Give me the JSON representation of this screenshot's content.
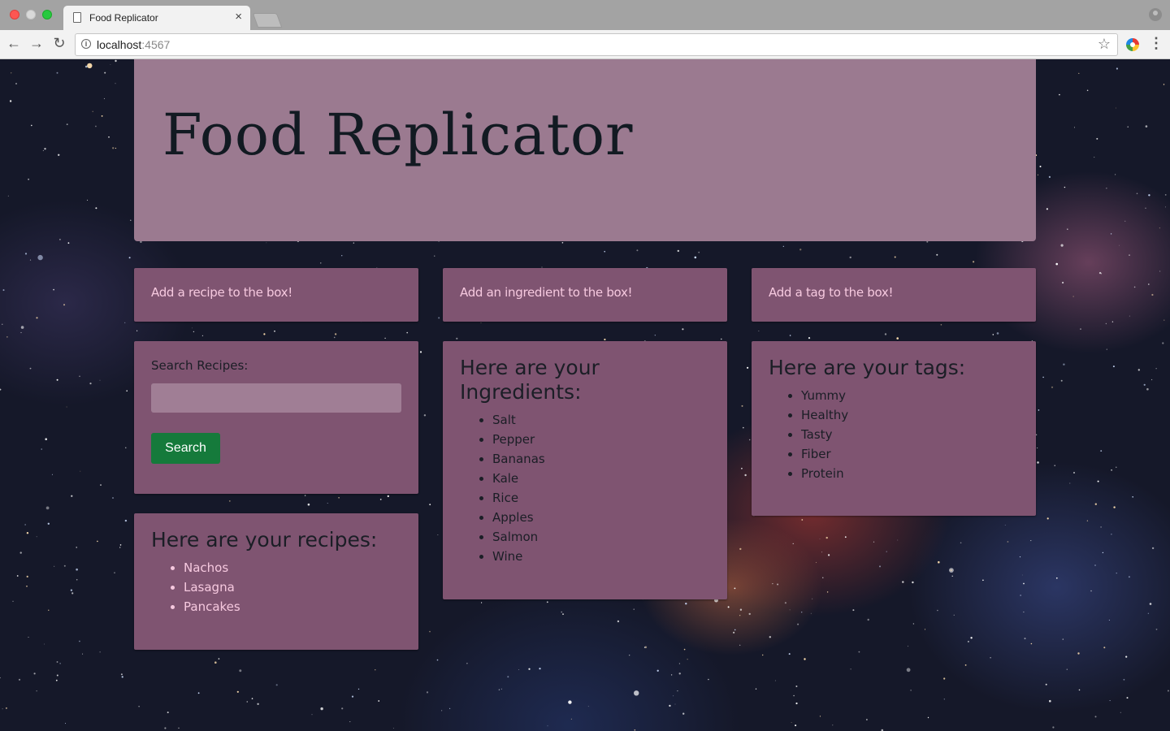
{
  "browser": {
    "tab_title": "Food Replicator",
    "tab_close": "×",
    "url_host": "localhost",
    "url_port": ":4567",
    "back": "←",
    "forward": "→",
    "reload": "↻",
    "star": "☆",
    "menu": "⋮",
    "info": "i"
  },
  "page": {
    "title": "Food Replicator",
    "add_recipe_link": "Add a recipe to the box!",
    "add_ingredient_link": "Add an ingredient to the box!",
    "add_tag_link": "Add a tag to the box!",
    "search": {
      "label": "Search Recipes:",
      "value": "",
      "button": "Search"
    },
    "recipes": {
      "heading": "Here are your recipes:",
      "items": [
        "Nachos",
        "Lasagna",
        "Pancakes"
      ]
    },
    "ingredients": {
      "heading": "Here are your Ingredients:",
      "items": [
        "Salt",
        "Pepper",
        "Bananas",
        "Kale",
        "Rice",
        "Apples",
        "Salmon",
        "Wine"
      ]
    },
    "tags": {
      "heading": "Here are your tags:",
      "items": [
        "Yummy",
        "Healthy",
        "Tasty",
        "Fiber",
        "Protein"
      ]
    }
  },
  "colors": {
    "panel": "#7f5471",
    "header": "#9b7a90",
    "link": "#f6c9df",
    "button": "#157a3b"
  }
}
